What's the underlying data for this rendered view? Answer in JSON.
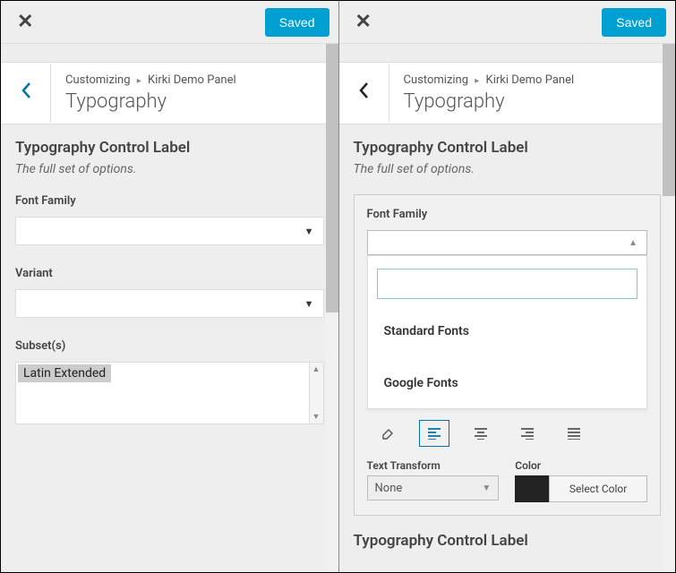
{
  "left": {
    "saved_label": "Saved",
    "breadcrumb_root": "Customizing",
    "breadcrumb_panel": "Kirki Demo Panel",
    "section_title": "Typography",
    "control_title": "Typography Control Label",
    "control_desc": "The full set of options.",
    "font_family_label": "Font Family",
    "font_family_value": "",
    "variant_label": "Variant",
    "variant_value": "",
    "subsets_label": "Subset(s)",
    "subsets_selected": "Latin Extended"
  },
  "right": {
    "saved_label": "Saved",
    "breadcrumb_root": "Customizing",
    "breadcrumb_panel": "Kirki Demo Panel",
    "section_title": "Typography",
    "control_title": "Typography Control Label",
    "control_desc": "The full set of options.",
    "font_family_label": "Font Family",
    "search_value": "",
    "group1": "Standard Fonts",
    "group2": "Google Fonts",
    "text_transform_label": "Text Transform",
    "text_transform_value": "None",
    "color_label": "Color",
    "color_button": "Select Color",
    "color_value": "#222222",
    "second_control_title": "Typography Control Label"
  }
}
